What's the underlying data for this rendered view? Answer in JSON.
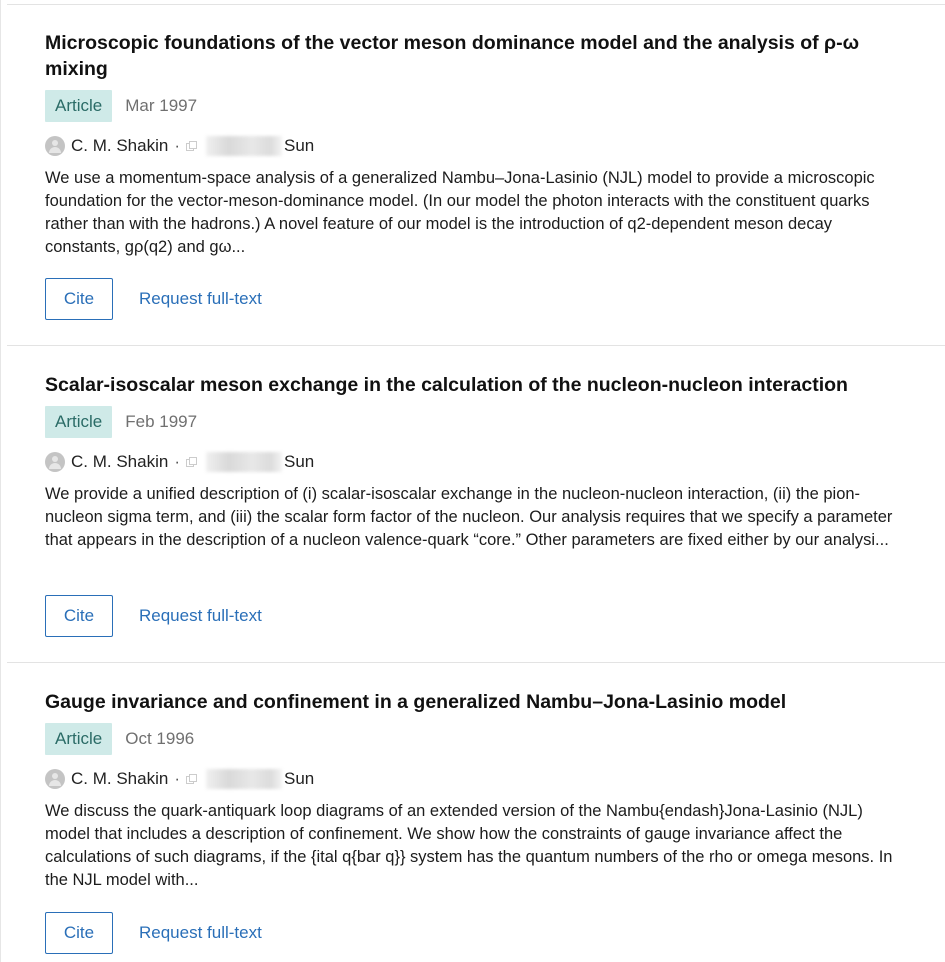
{
  "publications": [
    {
      "title": "Microscopic foundations of the vector meson dominance model and the analysis of ρ-ω mixing",
      "type": "Article",
      "date": "Mar 1997",
      "author1": "C. M. Shakin",
      "author2_suffix": "Sun",
      "abstract": "We use a momentum-space analysis of a generalized Nambu–Jona-Lasinio (NJL) model to provide a microscopic foundation for the vector-meson-dominance model. (In our model the photon interacts with the constituent quarks rather than with the hadrons.) A novel feature of our model is the introduction of q2-dependent meson decay constants, gρ(q2) and gω...",
      "cite_label": "Cite",
      "request_label": "Request full-text"
    },
    {
      "title": "Scalar-isoscalar meson exchange in the calculation of the nucleon-nucleon interaction",
      "type": "Article",
      "date": "Feb 1997",
      "author1": "C. M. Shakin",
      "author2_suffix": "Sun",
      "abstract": "We provide a unified description of (i) scalar-isoscalar exchange in the nucleon-nucleon interaction, (ii) the pion-nucleon sigma term, and (iii) the scalar form factor of the nucleon. Our analysis requires that we specify a parameter that appears in the description of a nucleon valence-quark “core.” Other parameters are fixed either by our analysi...",
      "cite_label": "Cite",
      "request_label": "Request full-text"
    },
    {
      "title": "Gauge invariance and confinement in a generalized Nambu–Jona-Lasinio model",
      "type": "Article",
      "date": "Oct 1996",
      "author1": "C. M. Shakin",
      "author2_suffix": "Sun",
      "abstract": "We discuss the quark-antiquark loop diagrams of an extended version of the Nambu{endash}Jona-Lasinio (NJL) model that includes a description of confinement. We show how the constraints of gauge invariance affect the calculations of such diagrams, if the {ital q{bar q}} system has the quantum numbers of the rho or omega mesons. In the NJL model with...",
      "cite_label": "Cite",
      "request_label": "Request full-text"
    }
  ],
  "colors": {
    "accent": "#2a6fb8",
    "badge_bg": "#cfeae8",
    "badge_text": "#2a6b66"
  },
  "icons": {
    "author_avatar": "user-avatar-icon",
    "copy": "copy-icon"
  }
}
